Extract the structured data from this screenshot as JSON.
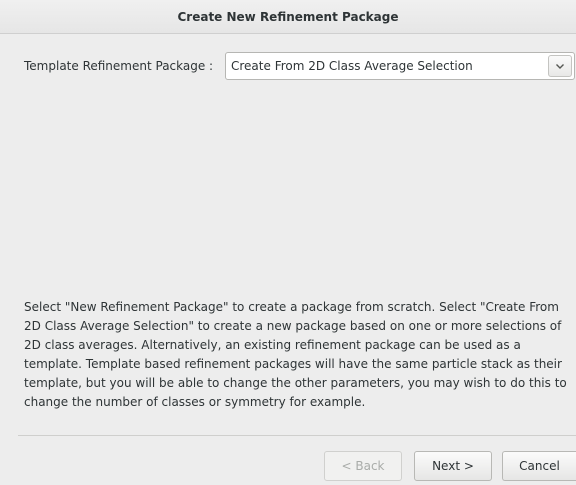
{
  "window": {
    "title": "Create New Refinement Package"
  },
  "template": {
    "label": "Template Refinement Package :",
    "selected_value": "Create From 2D Class Average Selection",
    "dropdown_icon": "chevron-down-icon"
  },
  "description": {
    "text": "Select \"New Refinement Package\" to create a package from scratch.  Select \"Create From 2D Class Average Selection\" to create a new package based on one or more selections of 2D class averages. Alternatively, an existing refinement package can be used as a template.  Template based refinement packages will have the same particle stack as their template, but you will be able to change the other parameters, you may wish to do this to change the number of classes or symmetry for example."
  },
  "buttons": {
    "back_label": "< Back",
    "next_label": "Next >",
    "cancel_label": "Cancel"
  }
}
